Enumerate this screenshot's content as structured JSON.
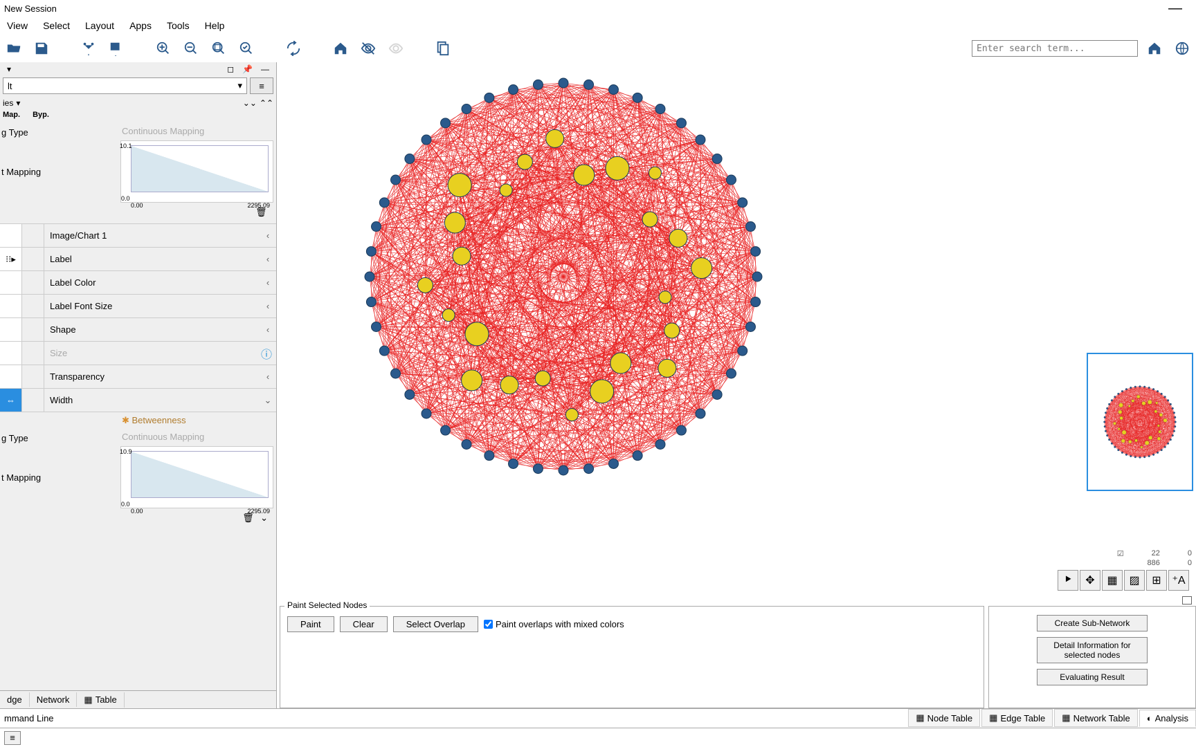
{
  "window": {
    "title": "New Session"
  },
  "menu": [
    "View",
    "Select",
    "Layout",
    "Apps",
    "Tools",
    "Help"
  ],
  "toolbar": {
    "search_placeholder": "Enter search term..."
  },
  "style_panel": {
    "selected_style": "lt",
    "section": "ies",
    "col_map": "Map.",
    "col_byp": "Byp.",
    "type_label": "g Type",
    "mapping_label": "t Mapping",
    "continuous_mapping": "Continuous Mapping",
    "betweenness": "Betweenness",
    "range_ymax1": "10.1",
    "range_ymax2": "10.9",
    "range_ymin": "0.0",
    "range_xmin": "0.00",
    "range_xmax": "2295.09",
    "properties": [
      {
        "name": "Image/Chart 1",
        "expand": "‹"
      },
      {
        "name": "Label",
        "expand": "‹",
        "drag": true
      },
      {
        "name": "Label Color",
        "expand": "‹"
      },
      {
        "name": "Label Font Size",
        "expand": "‹"
      },
      {
        "name": "Shape",
        "expand": "‹"
      },
      {
        "name": "Size",
        "expand": "",
        "info": true,
        "faded": true
      },
      {
        "name": "Transparency",
        "expand": "‹"
      },
      {
        "name": "Width",
        "expand": "⌄",
        "active": true
      }
    ],
    "bottom_tabs": [
      "dge",
      "Network",
      "Table"
    ]
  },
  "paint_panel": {
    "legend": "Paint Selected Nodes",
    "paint_btn": "Paint",
    "clear_btn": "Clear",
    "overlap_btn": "Select Overlap",
    "mix_check": "Paint overlaps with mixed colors"
  },
  "action_panel": {
    "create_sub": "Create Sub-Network",
    "detail_info": "Detail Information for selected nodes",
    "eval_result": "Evaluating Result"
  },
  "stats": {
    "nodes": "22",
    "nodes_sel": "0",
    "edges": "886",
    "edges_sel": "0"
  },
  "table_tabs": [
    "Node Table",
    "Edge Table",
    "Network Table",
    "Analysis"
  ],
  "cmd_line": "mmand Line"
}
